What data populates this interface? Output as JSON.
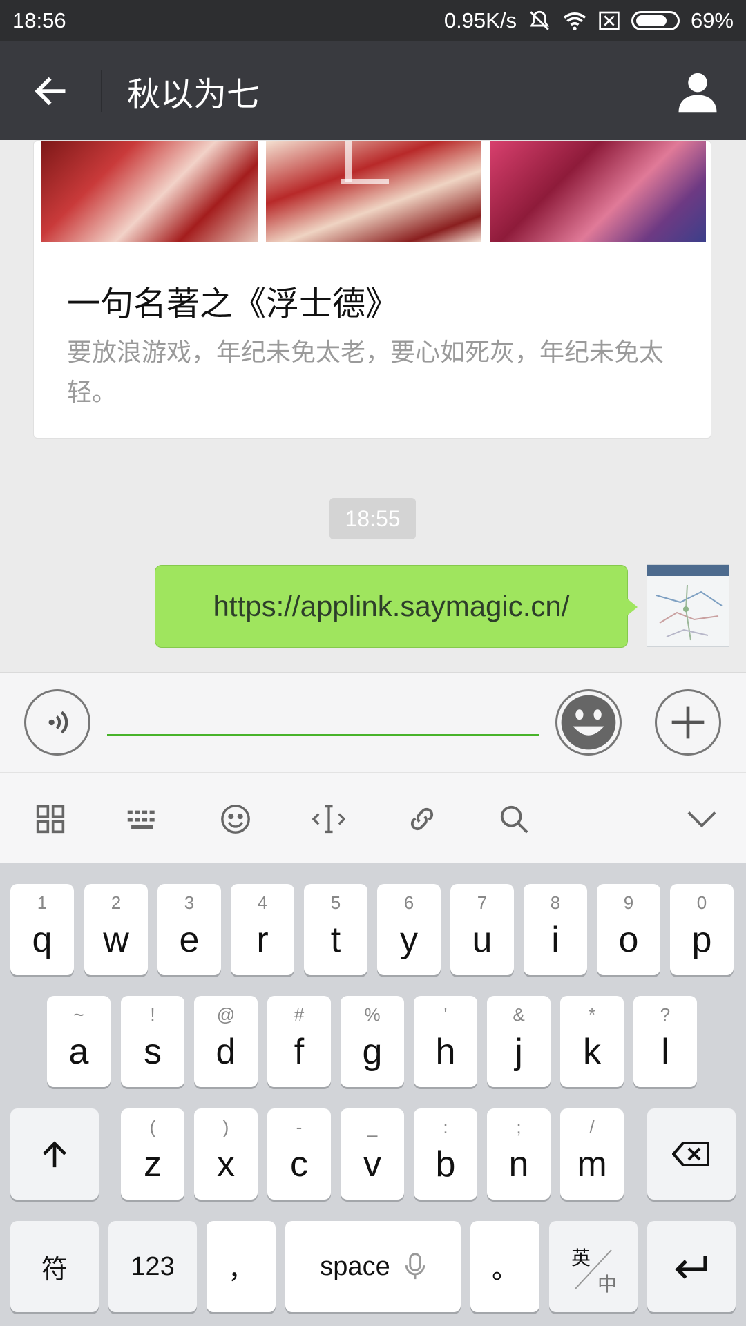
{
  "status_bar": {
    "time": "18:56",
    "net_speed": "0.95K/s",
    "battery": "69%"
  },
  "title_bar": {
    "title": "秋以为七"
  },
  "chat": {
    "card": {
      "title": "一句名著之《浮士德》",
      "description": "要放浪游戏，年纪未免太老，要心如死灰，年纪未免太轻。"
    },
    "timestamp": "18:55",
    "message": "https://applink.saymagic.cn/"
  },
  "keyboard": {
    "row1": [
      {
        "sub": "1",
        "main": "q"
      },
      {
        "sub": "2",
        "main": "w"
      },
      {
        "sub": "3",
        "main": "e"
      },
      {
        "sub": "4",
        "main": "r"
      },
      {
        "sub": "5",
        "main": "t"
      },
      {
        "sub": "6",
        "main": "y"
      },
      {
        "sub": "7",
        "main": "u"
      },
      {
        "sub": "8",
        "main": "i"
      },
      {
        "sub": "9",
        "main": "o"
      },
      {
        "sub": "0",
        "main": "p"
      }
    ],
    "row2": [
      {
        "sub": "~",
        "main": "a"
      },
      {
        "sub": "!",
        "main": "s"
      },
      {
        "sub": "@",
        "main": "d"
      },
      {
        "sub": "#",
        "main": "f"
      },
      {
        "sub": "%",
        "main": "g"
      },
      {
        "sub": "'",
        "main": "h"
      },
      {
        "sub": "&",
        "main": "j"
      },
      {
        "sub": "*",
        "main": "k"
      },
      {
        "sub": "?",
        "main": "l"
      }
    ],
    "row3": [
      {
        "sub": "(",
        "main": "z"
      },
      {
        "sub": ")",
        "main": "x"
      },
      {
        "sub": "-",
        "main": "c"
      },
      {
        "sub": "_",
        "main": "v"
      },
      {
        "sub": ":",
        "main": "b"
      },
      {
        "sub": ";",
        "main": "n"
      },
      {
        "sub": "/",
        "main": "m"
      }
    ],
    "symbols_label": "符",
    "numbers_label": "123",
    "comma_label": "，",
    "space_label": "space",
    "period_label": "。",
    "lang_en": "英",
    "lang_zh": "中"
  }
}
